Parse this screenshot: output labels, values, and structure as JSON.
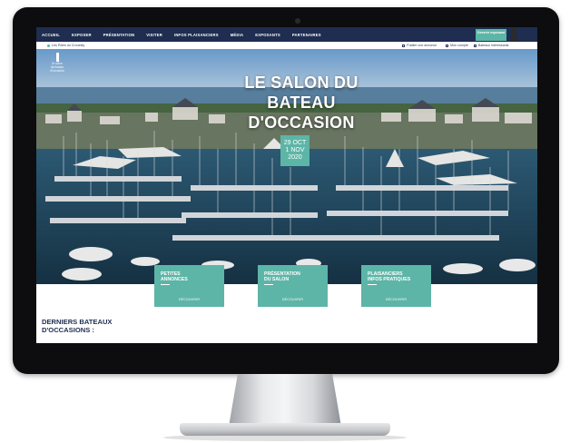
{
  "nav": {
    "items": [
      "ACCUEIL",
      "EXPOSER",
      "PRÉSENTATION",
      "VISITER",
      "INFOS PLAISANCIERS",
      "MÉDIA",
      "EXPOSANTS",
      "PARTENAIRES"
    ],
    "cta": "Devenir exposant"
  },
  "subbar": {
    "left": "Les Pôles du Crouesty",
    "links": [
      "Publier une annonce",
      "Mon compte",
      "Bateaux intéressants"
    ]
  },
  "logo": {
    "line1": "le salon",
    "line2": "du bateau",
    "line3": "d'occasion"
  },
  "hero": {
    "title": "LE SALON DU BATEAU D'OCCASION",
    "date": {
      "line1": "29 OCT",
      "line2": "1 NOV",
      "line3": "2020"
    }
  },
  "cards": [
    {
      "title1": "PETITES",
      "title2": "ANNONCES",
      "sub": "DÉCOUVRIR"
    },
    {
      "title1": "PRÉSENTATION",
      "title2": "DU SALON",
      "sub": "DÉCOUVRIR"
    },
    {
      "title1": "PLAISANCIERS",
      "title2": "INFOS PRATIQUES",
      "sub": "DÉCOUVRIR"
    }
  ],
  "section": {
    "line1": "DERNIERS BATEAUX",
    "line2": "D'OCCASIONS :"
  },
  "colors": {
    "navy": "#1e2d50",
    "teal": "#5db5a7"
  }
}
